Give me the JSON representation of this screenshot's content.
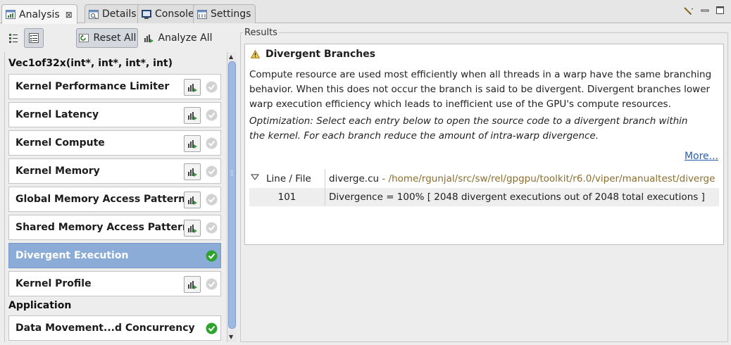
{
  "tabs": [
    {
      "label": "Analysis",
      "icon": "analysis-icon",
      "active": true,
      "closable": true
    },
    {
      "label": "Details",
      "icon": "details-icon"
    },
    {
      "label": "Console",
      "icon": "console-icon"
    },
    {
      "label": "Settings",
      "icon": "settings-icon"
    }
  ],
  "toolbar": {
    "reset_label": "Reset All",
    "analyze_label": "Analyze All"
  },
  "kernel": {
    "title": "Vec1of32x(int*, int*, int*, int)",
    "items": [
      {
        "label": "Kernel Performance Limiter",
        "status": "pending"
      },
      {
        "label": "Kernel Latency",
        "status": "pending"
      },
      {
        "label": "Kernel Compute",
        "status": "pending"
      },
      {
        "label": "Kernel Memory",
        "status": "pending"
      },
      {
        "label": "Global Memory Access Pattern",
        "status": "pending"
      },
      {
        "label": "Shared Memory Access Pattern",
        "status": "pending"
      },
      {
        "label": "Divergent Execution",
        "status": "done",
        "selected": true
      },
      {
        "label": "Kernel Profile",
        "status": "pending"
      }
    ]
  },
  "application": {
    "title": "Application",
    "items": [
      {
        "label": "Data Movement...d Concurrency",
        "status": "done"
      }
    ]
  },
  "results": {
    "legend": "Results",
    "title": "Divergent Branches",
    "description": "Compute resource are used most efficiently when all threads in a warp have the same branching behavior. When this does not occur the branch is said to be divergent. Divergent branches lower warp execution efficiency which leads to inefficient use of the GPU's compute resources.",
    "optimization": "Optimization: Select each entry below to open the source code to a divergent branch within the kernel. For each branch reduce the amount of intra-warp divergence.",
    "more_link": "More...",
    "table": {
      "col_header": "Line / File",
      "file": "diverge.cu",
      "path": " - /home/rgunjal/src/sw/rel/gpgpu/toolkit/r6.0/viper/manualtest/diverge",
      "rows": [
        {
          "line": "101",
          "value": "Divergence = 100% [ 2048 divergent executions out of 2048 total executions ]"
        }
      ]
    }
  },
  "colors": {
    "selected_row": "#8cacd8",
    "success": "#2ea32e",
    "pending": "#c8c8c8",
    "link": "#2a5db0",
    "path_text": "#8a6d2c"
  }
}
